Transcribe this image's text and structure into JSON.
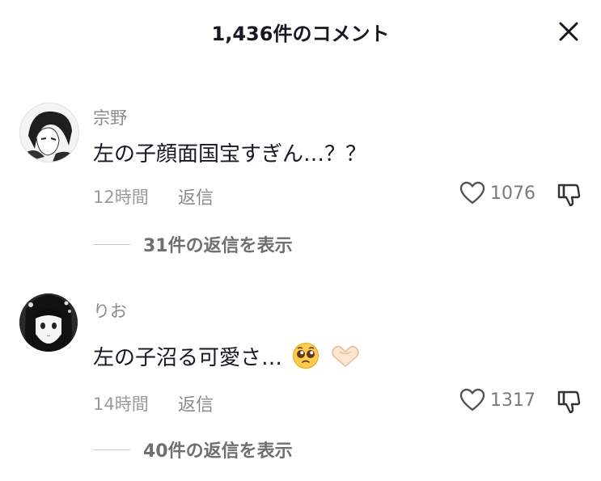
{
  "header": {
    "title": "1,436件のコメント",
    "close_icon": "close-icon"
  },
  "comments": [
    {
      "username": "宗野",
      "text": "左の子顔面国宝すぎん…？？",
      "time": "12時間",
      "reply_label": "返信",
      "likes": "1076",
      "view_replies": "31件の返信を表示",
      "avatar_icon": "anime-character-avatar"
    },
    {
      "username": "りお",
      "text": "左の子沼る可愛さ…",
      "emojis": [
        "pleading-face-emoji",
        "heart-hands-emoji"
      ],
      "time": "14時間",
      "reply_label": "返信",
      "likes": "1317",
      "view_replies": "40件の返信を表示",
      "avatar_icon": "anime-character-avatar"
    }
  ],
  "colors": {
    "text": "#161823",
    "muted": "#8a8a8a",
    "background": "#ffffff"
  }
}
